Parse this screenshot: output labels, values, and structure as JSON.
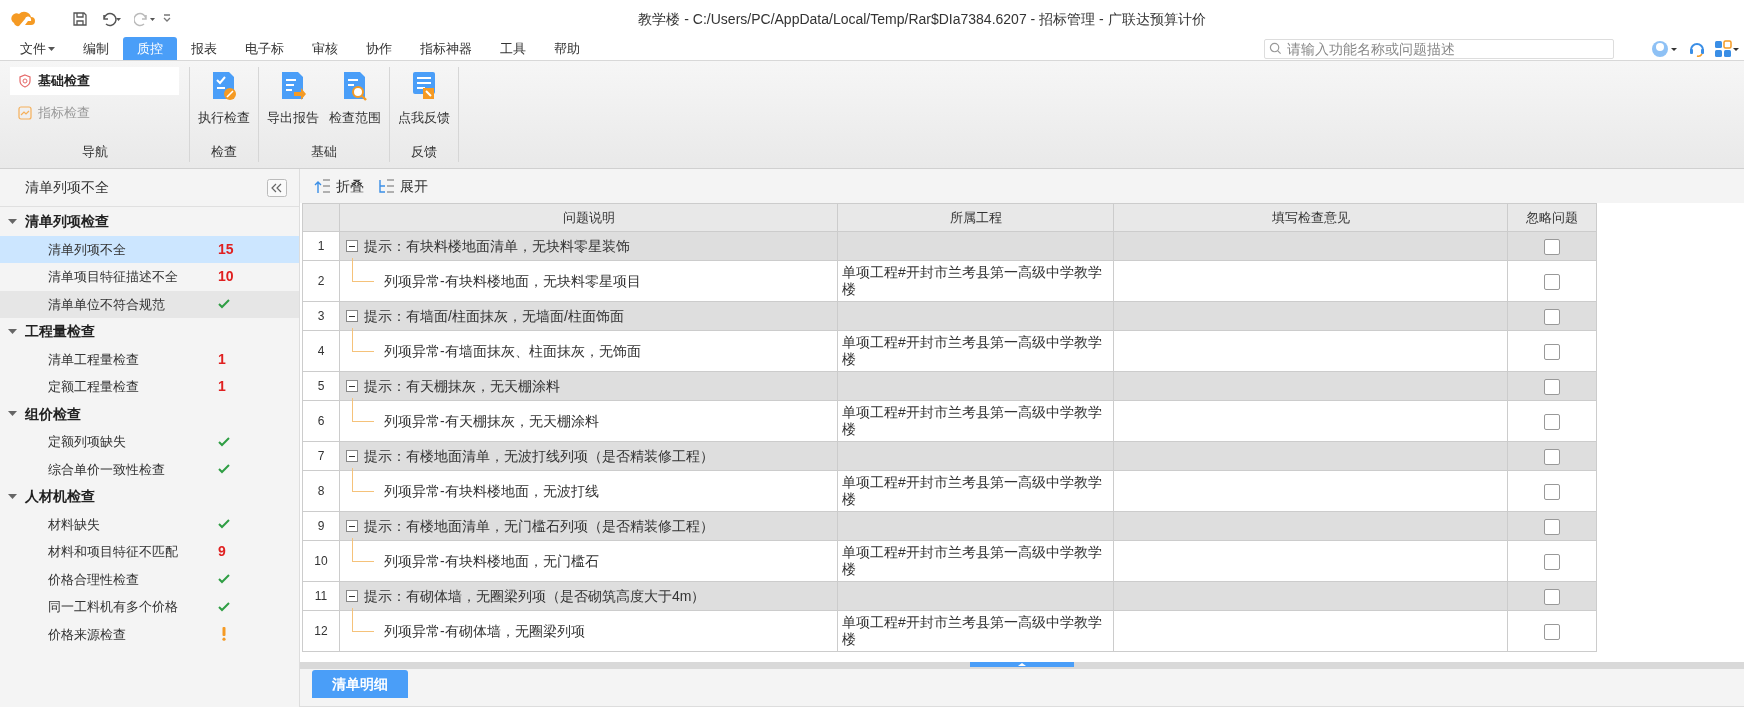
{
  "window": {
    "title": "教学楼 - C:/Users/PC/AppData/Local/Temp/Rar$DIa7384.6207 - 招标管理 - 广联达预算计价"
  },
  "menu": [
    {
      "label": "文件",
      "dropdown": true,
      "selected": false
    },
    {
      "label": "编制",
      "dropdown": false,
      "selected": false
    },
    {
      "label": "质控",
      "dropdown": false,
      "selected": true
    },
    {
      "label": "报表",
      "dropdown": false,
      "selected": false
    },
    {
      "label": "电子标",
      "dropdown": false,
      "selected": false
    },
    {
      "label": "审核",
      "dropdown": false,
      "selected": false
    },
    {
      "label": "协作",
      "dropdown": false,
      "selected": false
    },
    {
      "label": "指标神器",
      "dropdown": false,
      "selected": false
    },
    {
      "label": "工具",
      "dropdown": false,
      "selected": false
    },
    {
      "label": "帮助",
      "dropdown": false,
      "selected": false
    }
  ],
  "search": {
    "placeholder": "请输入功能名称或问题描述"
  },
  "ribbon": {
    "nav": {
      "items": [
        {
          "label": "基础检查",
          "selected": true
        },
        {
          "label": "指标检查",
          "selected": false
        }
      ],
      "group": "导航"
    },
    "groups": [
      {
        "label": "检查",
        "buttons": [
          {
            "label": "执行检查",
            "kind": "run"
          }
        ]
      },
      {
        "label": "基础",
        "buttons": [
          {
            "label": "导出报告",
            "kind": "export"
          },
          {
            "label": "检查范围",
            "kind": "scope"
          }
        ]
      },
      {
        "label": "反馈",
        "buttons": [
          {
            "label": "点我反馈",
            "kind": "feedback"
          }
        ]
      }
    ]
  },
  "sidebar": {
    "title": "清单列项不全",
    "sections": [
      {
        "label": "清单列项检查",
        "expanded": true,
        "items": [
          {
            "label": "清单列项不全",
            "kind": "count",
            "count": "15",
            "selected": true,
            "hovered": false
          },
          {
            "label": "清单项目特征描述不全",
            "kind": "count",
            "count": "10",
            "selected": false,
            "hovered": false
          },
          {
            "label": "清单单位不符合规范",
            "kind": "ok",
            "selected": false,
            "hovered": true
          }
        ]
      },
      {
        "label": "工程量检查",
        "expanded": true,
        "items": [
          {
            "label": "清单工程量检查",
            "kind": "count",
            "count": "1",
            "selected": false,
            "hovered": false
          },
          {
            "label": "定额工程量检查",
            "kind": "count",
            "count": "1",
            "selected": false,
            "hovered": false
          }
        ]
      },
      {
        "label": "组价检查",
        "expanded": true,
        "items": [
          {
            "label": "定额列项缺失",
            "kind": "ok",
            "selected": false,
            "hovered": false
          },
          {
            "label": "综合单价一致性检查",
            "kind": "ok",
            "selected": false,
            "hovered": false
          }
        ]
      },
      {
        "label": "人材机检查",
        "expanded": true,
        "items": [
          {
            "label": "材料缺失",
            "kind": "ok",
            "selected": false,
            "hovered": false
          },
          {
            "label": "材料和项目特征不匹配",
            "kind": "count",
            "count": "9",
            "selected": false,
            "hovered": false
          },
          {
            "label": "价格合理性检查",
            "kind": "ok",
            "selected": false,
            "hovered": false
          },
          {
            "label": "同一工料机有多个价格",
            "kind": "ok",
            "selected": false,
            "hovered": false
          },
          {
            "label": "价格来源检查",
            "kind": "warn",
            "selected": false,
            "hovered": false
          }
        ]
      }
    ]
  },
  "toolbar": [
    {
      "label": "折叠",
      "kind": "collapse"
    },
    {
      "label": "展开",
      "kind": "expand"
    }
  ],
  "table": {
    "columns": [
      "问题说明",
      "所属工程",
      "填写检查意见",
      "忽略问题"
    ],
    "rows": [
      {
        "no": "1",
        "kind": "group",
        "expanded": true,
        "text": "提示：有块料楼地面清单，无块料零星装饰",
        "checked": false
      },
      {
        "no": "2",
        "kind": "item",
        "text": "列项异常-有块料楼地面，无块料零星项目",
        "project": "单项工程#开封市兰考县第一高级中学教学楼",
        "checked": false
      },
      {
        "no": "3",
        "kind": "group",
        "expanded": true,
        "text": "提示：有墙面/柱面抹灰，无墙面/柱面饰面",
        "checked": false
      },
      {
        "no": "4",
        "kind": "item",
        "text": "列项异常-有墙面抹灰、柱面抹灰，无饰面",
        "project": "单项工程#开封市兰考县第一高级中学教学楼",
        "checked": false
      },
      {
        "no": "5",
        "kind": "group",
        "expanded": true,
        "text": "提示：有天棚抹灰，无天棚涂料",
        "checked": false
      },
      {
        "no": "6",
        "kind": "item",
        "text": "列项异常-有天棚抹灰，无天棚涂料",
        "project": "单项工程#开封市兰考县第一高级中学教学楼",
        "checked": false
      },
      {
        "no": "7",
        "kind": "group",
        "expanded": true,
        "text": "提示：有楼地面清单，无波打线列项（是否精装修工程）",
        "checked": false
      },
      {
        "no": "8",
        "kind": "item",
        "text": "列项异常-有块料楼地面，无波打线",
        "project": "单项工程#开封市兰考县第一高级中学教学楼",
        "checked": false
      },
      {
        "no": "9",
        "kind": "group",
        "expanded": true,
        "text": "提示：有楼地面清单，无门槛石列项（是否精装修工程）",
        "checked": false
      },
      {
        "no": "10",
        "kind": "item",
        "text": "列项异常-有块料楼地面，无门槛石",
        "project": "单项工程#开封市兰考县第一高级中学教学楼",
        "checked": false
      },
      {
        "no": "11",
        "kind": "group",
        "expanded": true,
        "text": "提示：有砌体墙，无圈梁列项（是否砌筑高度大于4m）",
        "checked": false
      },
      {
        "no": "12",
        "kind": "item",
        "text": "列项异常-有砌体墙，无圈梁列项",
        "project": "单项工程#开封市兰考县第一高级中学教学楼",
        "checked": false
      }
    ]
  },
  "bottom_tabs": [
    {
      "label": "清单明细",
      "selected": true
    }
  ]
}
